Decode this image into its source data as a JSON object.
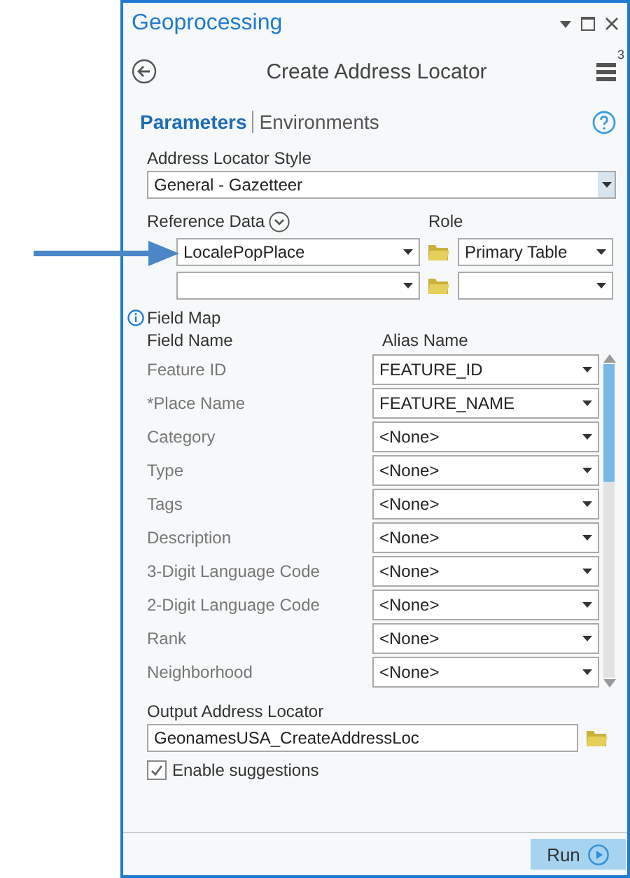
{
  "pane": {
    "title": "Geoprocessing"
  },
  "tool": {
    "title": "Create Address Locator",
    "badge": "3"
  },
  "tabs": [
    {
      "label": "Parameters",
      "selected": true
    },
    {
      "label": "Environments",
      "selected": false
    }
  ],
  "address_locator_style": {
    "label": "Address Locator Style",
    "value": "General - Gazetteer"
  },
  "reference_data": {
    "label": "Reference Data",
    "role_label": "Role",
    "rows": [
      {
        "value": "LocalePopPlace",
        "role": "Primary Table"
      },
      {
        "value": "",
        "role": ""
      }
    ]
  },
  "field_map": {
    "title": "Field Map",
    "columns": [
      "Field Name",
      "Alias Name"
    ],
    "rows": [
      {
        "field": "Feature ID",
        "alias": "FEATURE_ID"
      },
      {
        "field": "*Place Name",
        "alias": "FEATURE_NAME"
      },
      {
        "field": "Category",
        "alias": "<None>"
      },
      {
        "field": "Type",
        "alias": "<None>"
      },
      {
        "field": "Tags",
        "alias": "<None>"
      },
      {
        "field": "Description",
        "alias": "<None>"
      },
      {
        "field": "3-Digit Language Code",
        "alias": "<None>"
      },
      {
        "field": "2-Digit Language Code",
        "alias": "<None>"
      },
      {
        "field": "Rank",
        "alias": "<None>"
      },
      {
        "field": "Neighborhood",
        "alias": "<None>"
      }
    ]
  },
  "output_address_locator": {
    "label": "Output Address Locator",
    "value": "GeonamesUSA_CreateAddressLoc"
  },
  "enable_suggestions": {
    "label": "Enable suggestions",
    "checked": true
  },
  "run_button": {
    "label": "Run"
  }
}
